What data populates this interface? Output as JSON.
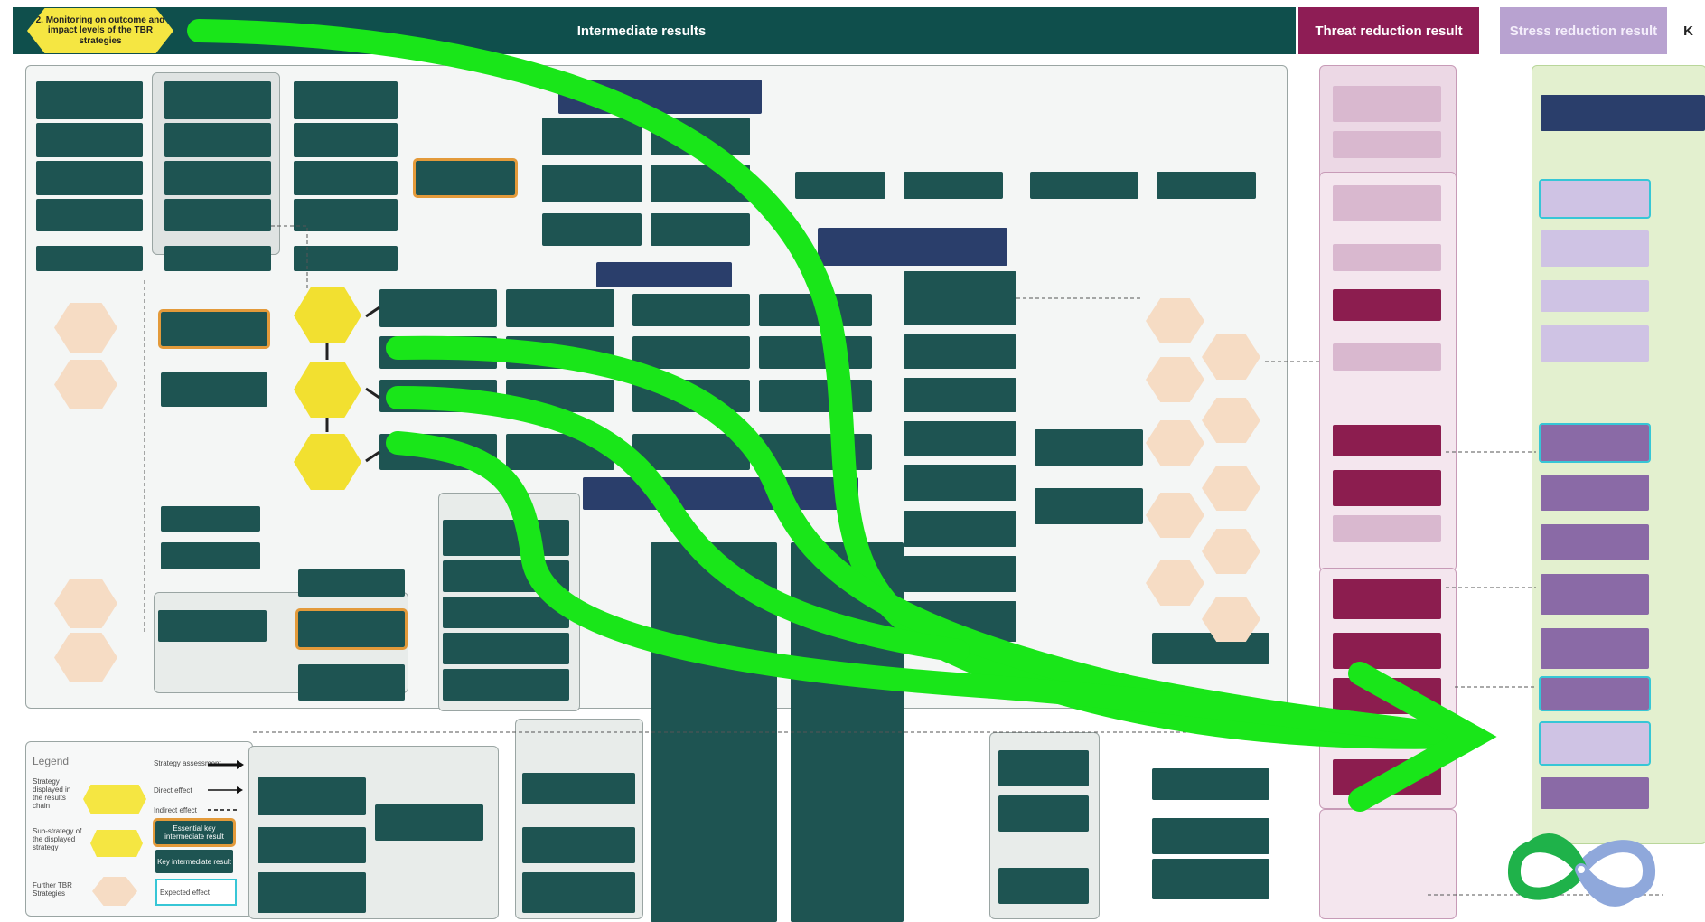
{
  "headers": {
    "monitoring": "2. Monitoring on outcome and impact levels of the TBR strategies",
    "intermediate": "Intermediate results",
    "threat": "Threat reduction result",
    "stress": "Stress reduction result",
    "cut": "K"
  },
  "colors": {
    "header_teal": "#0f4f4c",
    "threat_maroon": "#8e1d55",
    "stress_purple": "#b8a2d0",
    "box_teal": "#1e5452",
    "box_navy": "#2a3e6b",
    "strategy_yellow": "#f5e642",
    "arrow_green": "#19e619",
    "conservation_green": "#e3f0cf"
  },
  "legend": {
    "title": "Legend",
    "rows": [
      "Strategy displayed in the results chain",
      "Sub-strategy of the displayed strategy",
      "Further TBR Strategies"
    ],
    "arrows": [
      "Strategy assessment",
      "Direct effect",
      "Indirect effect"
    ],
    "key_items": [
      "Essential key intermediate result",
      "Key intermediate result",
      "Expected effect"
    ]
  },
  "icons": [
    "curved-arrow-icon",
    "infinity-logo-icon"
  ]
}
